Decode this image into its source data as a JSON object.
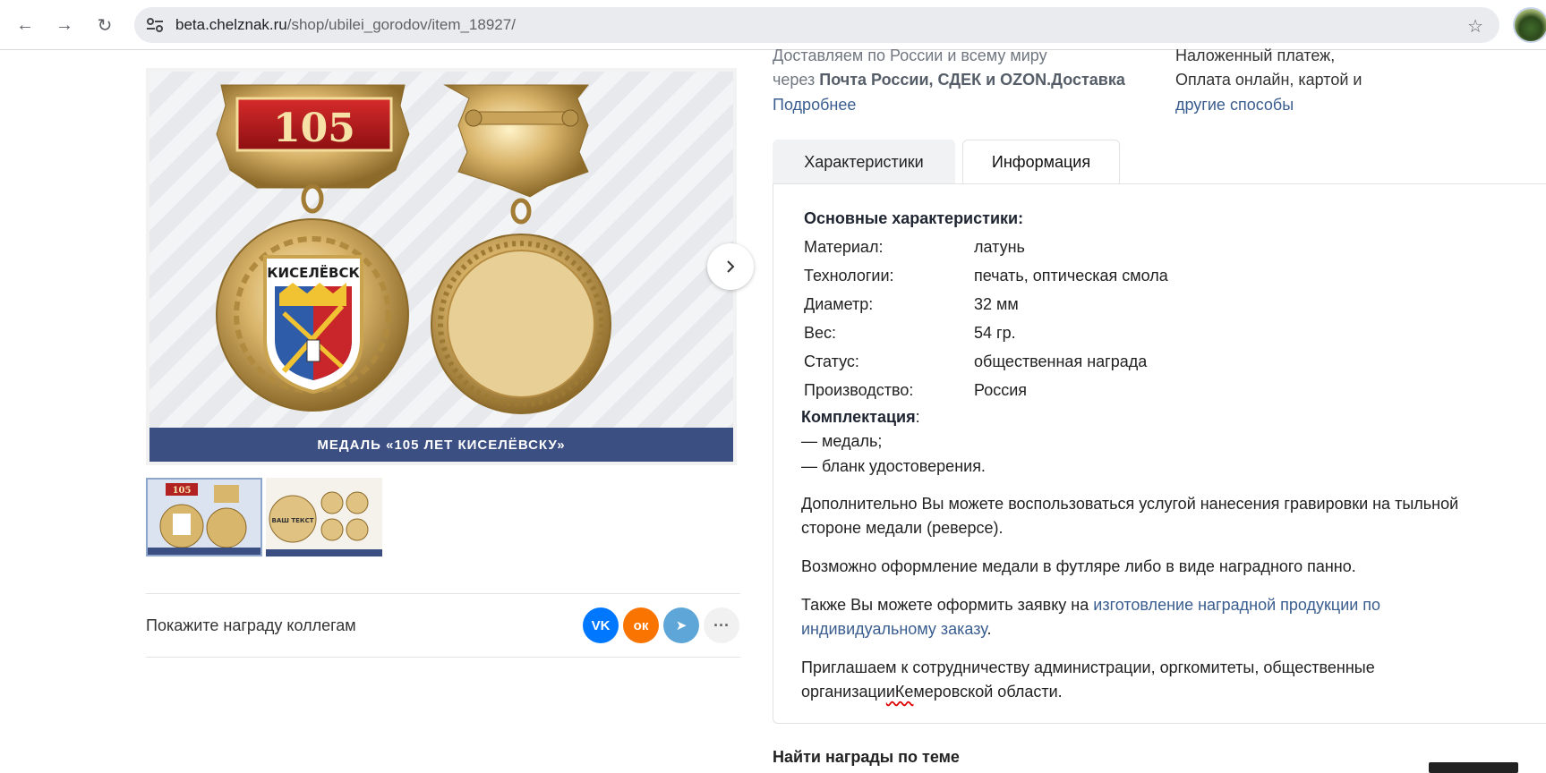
{
  "browser": {
    "url_host": "beta.chelznak.ru",
    "url_path": "/shop/ubilei_gorodov/item_18927/"
  },
  "gallery": {
    "caption": "МЕДАЛЬ «105 ЛЕТ КИСЕЛЁВСКУ»",
    "plaque_number": "105",
    "city_name": "КИСЕЛЁВСК",
    "thumb1_plaque": "105",
    "thumb2_text": "ВАШ ТЕКСТ"
  },
  "share": {
    "label": "Покажите награду коллегам",
    "vk": "VK",
    "ok": "ок",
    "tg": "➤",
    "more": "···"
  },
  "delivery": {
    "line1": "Доставляем по России и всему миру",
    "line2_prefix": "через ",
    "line2_bold": "Почта России, СДЕК и OZON.Доставка",
    "more_link": "Подробнее"
  },
  "payment": {
    "line1": "Наложенный платеж,",
    "line2": "Оплата онлайн, картой и",
    "link": "другие способы"
  },
  "tabs": {
    "characteristics": "Характеристики",
    "information": "Информация"
  },
  "specs": {
    "title": "Основные характеристики:",
    "rows": [
      {
        "key": "Материал:",
        "value": "латунь"
      },
      {
        "key": "Технологии:",
        "value": "печать, оптическая смола"
      },
      {
        "key": "Диаметр:",
        "value": "32 мм"
      },
      {
        "key": "Вес:",
        "value": "54 гр."
      },
      {
        "key": "Статус:",
        "value": "общественная награда"
      },
      {
        "key": "Производство:",
        "value": "Россия"
      }
    ],
    "kit_title": "Комплектация",
    "kit_colon": ":",
    "kit_items": [
      "— медаль;",
      "— бланк удостоверения."
    ]
  },
  "info": {
    "p1": "Дополнительно Вы можете воспользоваться услугой нанесения гравировки на тыльной стороне медали (реверсе).",
    "p2": "Возможно оформление медали в футляре либо в виде наградного панно.",
    "p3_prefix": "Также Вы можете оформить заявку на ",
    "p3_link": "изготовление наградной продукции по индивидуальному заказу",
    "p3_suffix": ".",
    "p4_a": "Приглашаем к сотрудничеству администрации, оргкомитеты, общественные организаци",
    "p4_b": "иКе",
    "p4_c": "меровской области."
  },
  "find": "Найти награды по теме"
}
